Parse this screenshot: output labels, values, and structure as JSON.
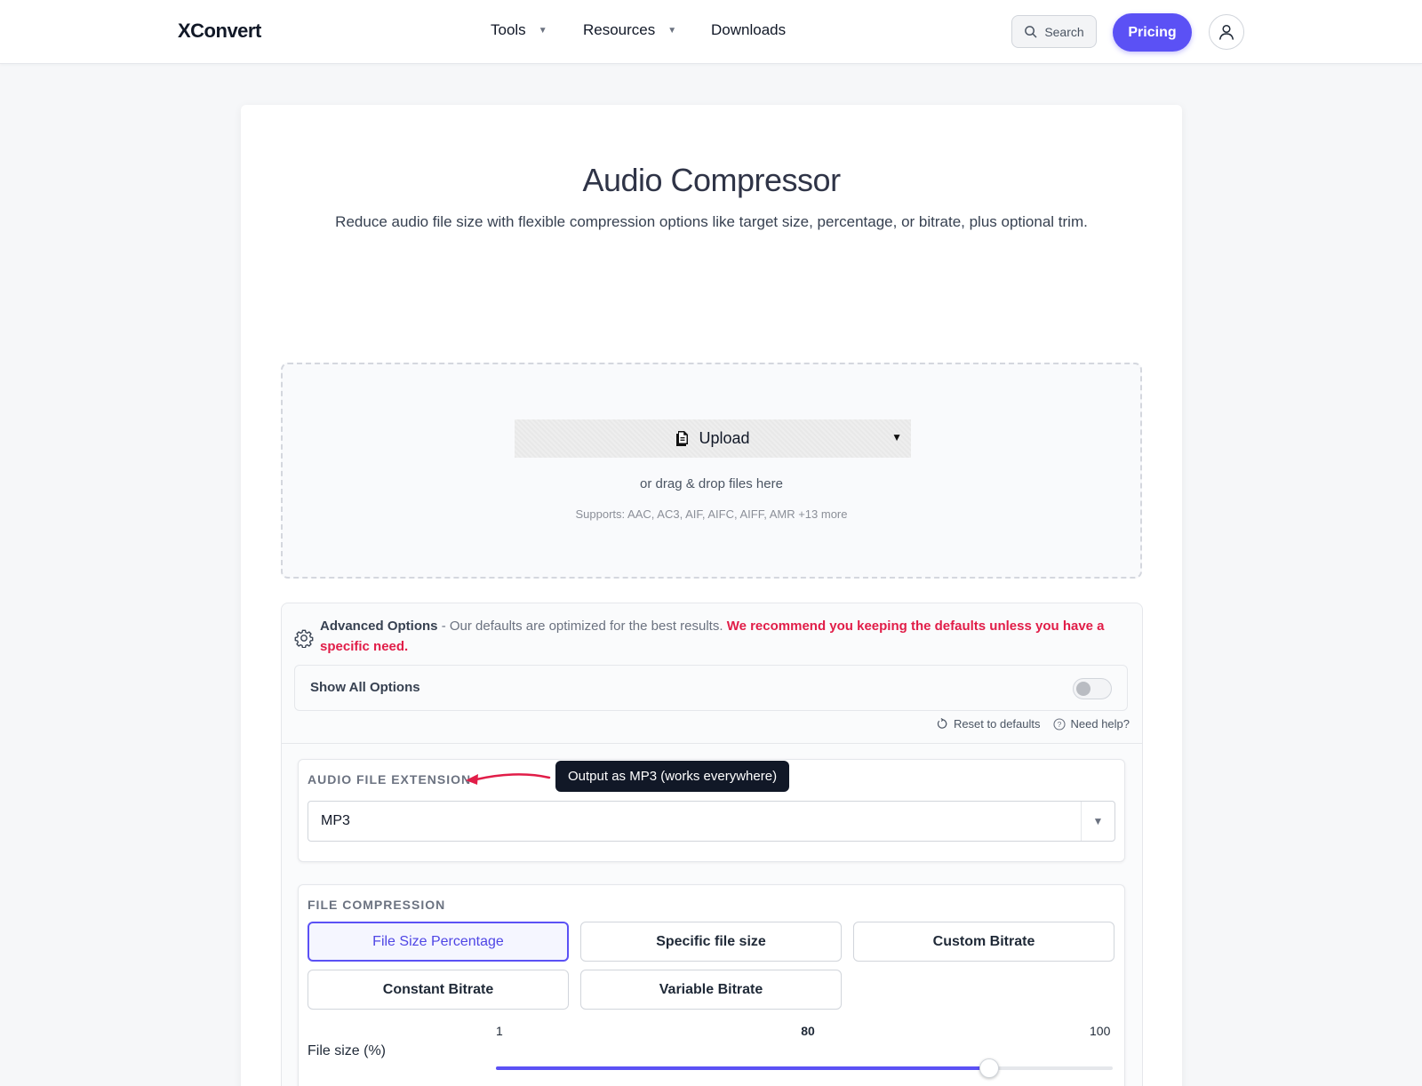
{
  "header": {
    "logo": "XConvert",
    "nav": [
      {
        "label": "Tools",
        "has_caret": true
      },
      {
        "label": "Resources",
        "has_caret": true
      },
      {
        "label": "Downloads",
        "has_caret": false
      }
    ],
    "search_label": "Search",
    "pricing_label": "Pricing",
    "accent_color": "#5b51f5"
  },
  "main": {
    "title": "Audio Compressor",
    "subtitle": "Reduce audio file size with flexible compression options like target size, percentage, or bitrate, plus optional trim.",
    "dropzone": {
      "upload_label": "Upload",
      "drag_text": "or drag & drop files here",
      "supports": "Supports: AAC, AC3, AIF, AIFC, AIFF, AMR +13 more"
    }
  },
  "advanced": {
    "title": "Advanced Options",
    "description": " - Our defaults are optimized for the best results. ",
    "warning": "We recommend you keeping the defaults unless you have a specific need.",
    "warning_color": "#e11d48",
    "show_all_label": "Show All Options",
    "show_all_enabled": false,
    "reset_label": "Reset to defaults",
    "help_label": "Need help?"
  },
  "extension": {
    "label": "AUDIO FILE EXTENSION",
    "value": "MP3",
    "tooltip": "Output as MP3 (works everywhere)"
  },
  "compression": {
    "label": "FILE COMPRESSION",
    "options": [
      {
        "label": "File Size Percentage",
        "active": true
      },
      {
        "label": "Specific file size",
        "active": false
      },
      {
        "label": "Custom Bitrate",
        "active": false
      },
      {
        "label": "Constant Bitrate",
        "active": false
      },
      {
        "label": "Variable Bitrate",
        "active": false
      }
    ],
    "slider": {
      "label": "File size (%)",
      "min": "1",
      "value": "80",
      "max": "100",
      "fraction": 0.8
    }
  }
}
